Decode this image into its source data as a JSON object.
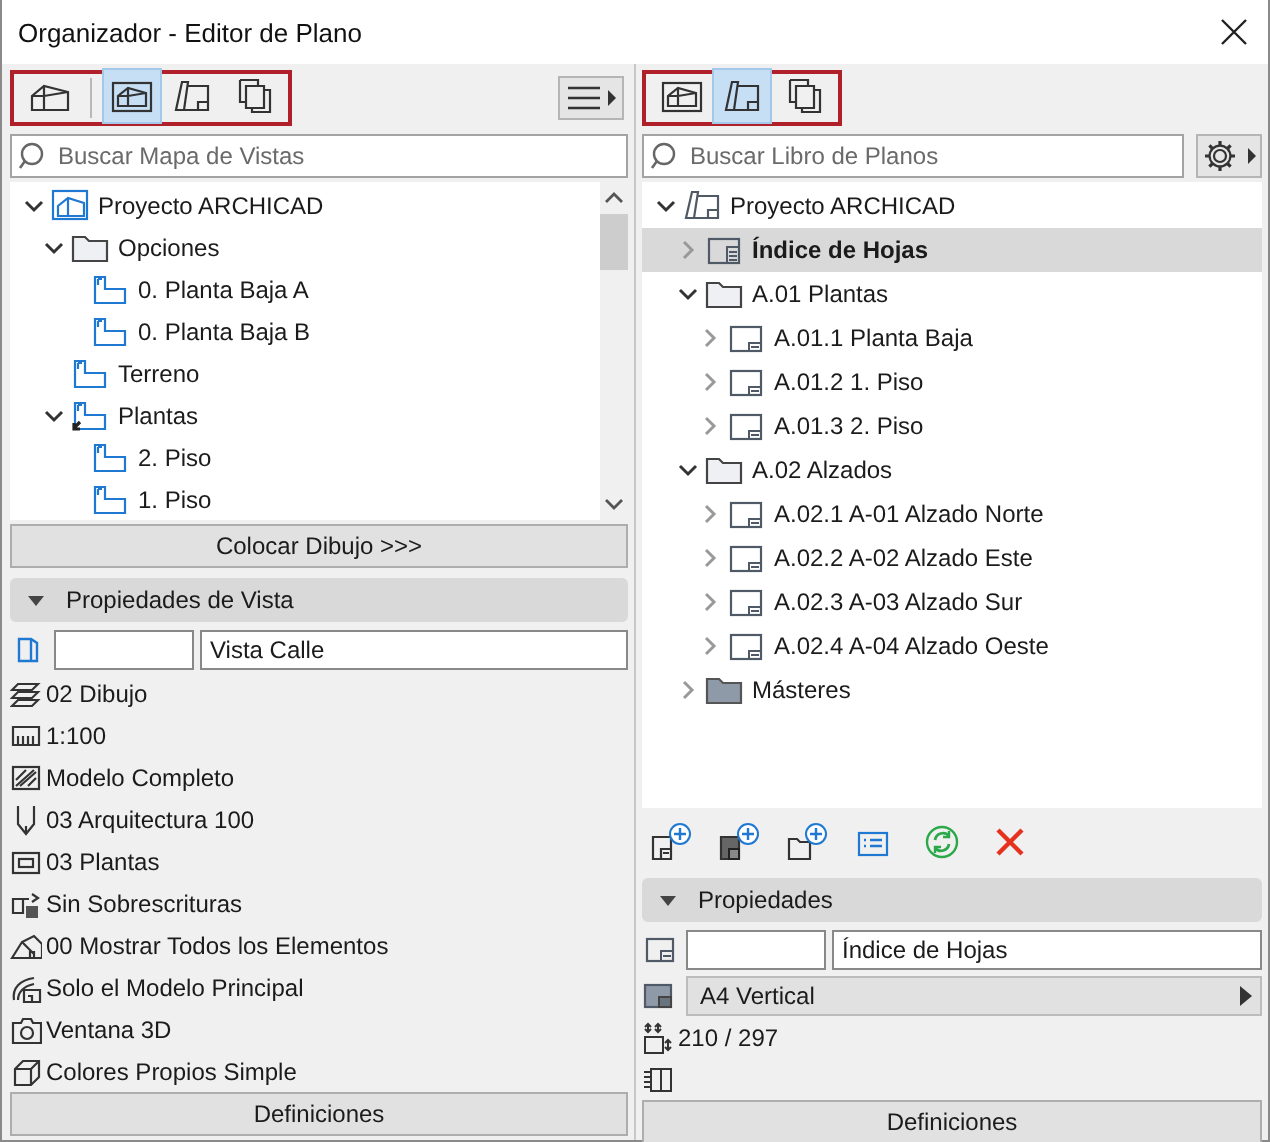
{
  "window": {
    "title": "Organizador - Editor de Plano"
  },
  "left_panel": {
    "toolbar": [
      {
        "kind": "project-map",
        "selected": false
      },
      {
        "kind": "view-map",
        "selected": true
      },
      {
        "kind": "layout-book",
        "selected": false
      },
      {
        "kind": "publisher",
        "selected": false
      }
    ],
    "search": {
      "placeholder": "Buscar Mapa de Vistas"
    },
    "tree": [
      {
        "label": "Proyecto ARCHICAD",
        "kind": "view-project",
        "expanded": true,
        "selected": false,
        "children": [
          {
            "label": "Opciones",
            "kind": "folder",
            "expanded": true,
            "selected": false,
            "children": [
              {
                "label": "0. Planta Baja A",
                "kind": "view",
                "selected": false
              },
              {
                "label": "0. Planta Baja B",
                "kind": "view",
                "selected": false
              }
            ]
          },
          {
            "label": "Terreno",
            "kind": "view",
            "selected": false
          },
          {
            "label": "Plantas",
            "kind": "view-folder",
            "expanded": true,
            "selected": false,
            "children": [
              {
                "label": "2. Piso",
                "kind": "view",
                "selected": false
              },
              {
                "label": "1. Piso",
                "kind": "view",
                "selected": false
              }
            ]
          }
        ]
      }
    ],
    "place_button": "Colocar Dibujo >>>",
    "properties": {
      "title": "Propiedades de Vista",
      "expanded": true,
      "name": "Vista Calle",
      "rows": [
        {
          "kind": "layers",
          "text": "02 Dibujo"
        },
        {
          "kind": "scale",
          "text": "1:100"
        },
        {
          "kind": "structure",
          "text": "Modelo Completo"
        },
        {
          "kind": "pen",
          "text": "03 Arquitectura 100"
        },
        {
          "kind": "plan",
          "text": "03 Plantas"
        },
        {
          "kind": "override",
          "text": "Sin Sobrescrituras"
        },
        {
          "kind": "house",
          "text": "00 Mostrar Todos los Elementos"
        },
        {
          "kind": "model",
          "text": "Solo el Modelo Principal"
        },
        {
          "kind": "camera",
          "text": "Ventana 3D"
        },
        {
          "kind": "cube",
          "text": "Colores Propios Simple"
        }
      ]
    },
    "definitions_button": "Definiciones"
  },
  "right_panel": {
    "toolbar": [
      {
        "kind": "view-map",
        "selected": false
      },
      {
        "kind": "layout-book",
        "selected": true
      },
      {
        "kind": "publisher",
        "selected": false
      }
    ],
    "search": {
      "placeholder": "Buscar Libro de Planos"
    },
    "tree": [
      {
        "label": "Proyecto ARCHICAD",
        "kind": "layout-project",
        "expanded": true,
        "selected": false,
        "children": [
          {
            "label": "Índice de Hojas",
            "kind": "sheet-index",
            "expanded": false,
            "selected": true
          },
          {
            "label": "A.01 Plantas",
            "kind": "folder",
            "expanded": true,
            "selected": false,
            "children": [
              {
                "label": "A.01.1 Planta Baja",
                "kind": "sheet",
                "expanded": false,
                "selected": false
              },
              {
                "label": "A.01.2 1. Piso",
                "kind": "sheet",
                "expanded": false,
                "selected": false
              },
              {
                "label": "A.01.3 2. Piso",
                "kind": "sheet",
                "expanded": false,
                "selected": false
              }
            ]
          },
          {
            "label": "A.02 Alzados",
            "kind": "folder",
            "expanded": true,
            "selected": false,
            "children": [
              {
                "label": "A.02.1 A-01 Alzado Norte",
                "kind": "sheet",
                "expanded": false,
                "selected": false
              },
              {
                "label": "A.02.2 A-02 Alzado Este",
                "kind": "sheet",
                "expanded": false,
                "selected": false
              },
              {
                "label": "A.02.3 A-03 Alzado Sur",
                "kind": "sheet",
                "expanded": false,
                "selected": false
              },
              {
                "label": "A.02.4 A-04 Alzado Oeste",
                "kind": "sheet",
                "expanded": false,
                "selected": false
              }
            ]
          },
          {
            "label": "Másteres",
            "kind": "master-folder",
            "expanded": false,
            "selected": false
          }
        ]
      }
    ],
    "properties": {
      "title": "Propiedades",
      "expanded": true,
      "name": "Índice de Hojas",
      "paper": "A4 Vertical",
      "size": "210 / 297"
    },
    "definitions_button": "Definiciones"
  }
}
